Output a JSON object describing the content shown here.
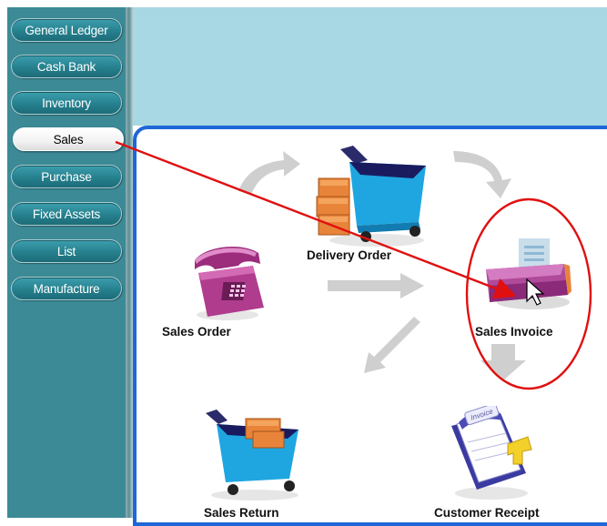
{
  "sidebar": {
    "items": [
      {
        "label": "General Ledger",
        "active": false
      },
      {
        "label": "Cash Bank",
        "active": false
      },
      {
        "label": "Inventory",
        "active": false
      },
      {
        "label": "Sales",
        "active": true
      },
      {
        "label": "Purchase",
        "active": false
      },
      {
        "label": "Fixed Assets",
        "active": false
      },
      {
        "label": "List",
        "active": false
      },
      {
        "label": "Manufacture",
        "active": false
      }
    ]
  },
  "workflow": {
    "sales_order": "Sales Order",
    "delivery_order": "Delivery Order",
    "sales_invoice": "Sales Invoice",
    "sales_return": "Sales Return",
    "customer_receipt": "Customer Receipt",
    "invoice_stamp": "Invoice"
  },
  "colors": {
    "sidebar_bg": "#3c8a96",
    "header_band": "#a7d8e3",
    "panel_border": "#1d67d8",
    "annotation": "#e01010",
    "flow_arrow": "#cfcfcf"
  },
  "icons": [
    "telephone-icon",
    "cart-with-boxes-icon",
    "printer-invoice-icon",
    "return-cart-icon",
    "receipt-icon",
    "mouse-cursor-icon"
  ]
}
